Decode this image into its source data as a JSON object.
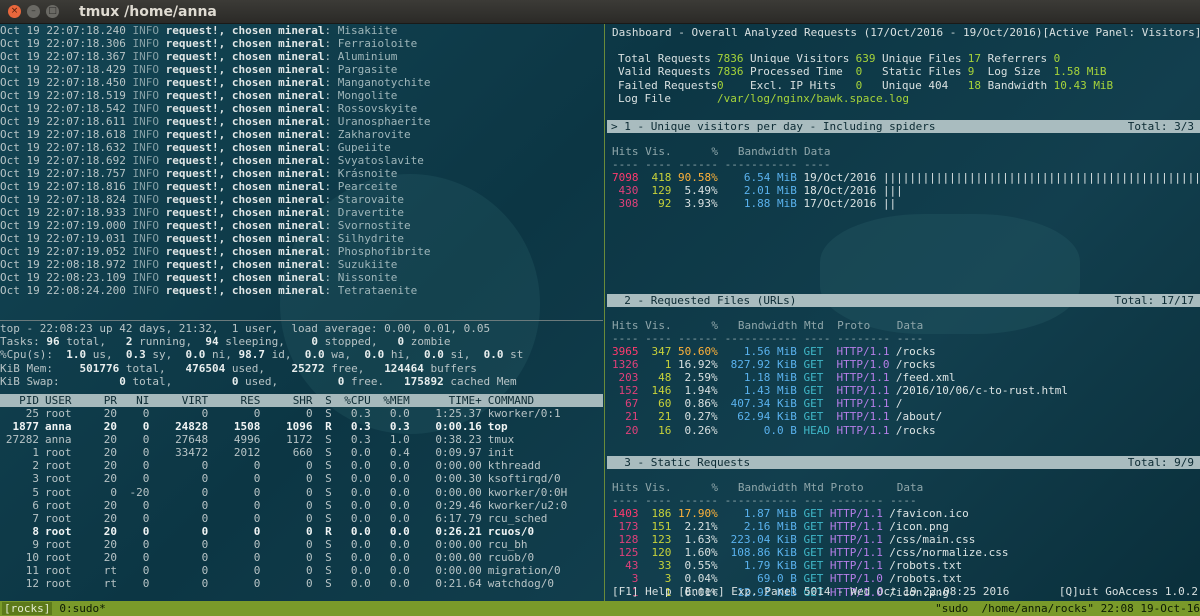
{
  "window": {
    "title": "tmux /home/anna",
    "close_glyph": "×",
    "min_glyph": "–",
    "max_glyph": "□"
  },
  "log_lines": [
    {
      "ts": "Oct 19 22:07:18.240",
      "lvl": "INFO",
      "msg1": "request!,",
      "msg2": "chosen mineral",
      "mineral": "Misakiite"
    },
    {
      "ts": "Oct 19 22:07:18.306",
      "lvl": "INFO",
      "msg1": "request!,",
      "msg2": "chosen mineral",
      "mineral": "Ferraioloite"
    },
    {
      "ts": "Oct 19 22:07:18.367",
      "lvl": "INFO",
      "msg1": "request!,",
      "msg2": "chosen mineral",
      "mineral": "Aluminium"
    },
    {
      "ts": "Oct 19 22:07:18.429",
      "lvl": "INFO",
      "msg1": "request!,",
      "msg2": "chosen mineral",
      "mineral": "Pargasite"
    },
    {
      "ts": "Oct 19 22:07:18.450",
      "lvl": "INFO",
      "msg1": "request!,",
      "msg2": "chosen mineral",
      "mineral": "Manganotychite"
    },
    {
      "ts": "Oct 19 22:07:18.519",
      "lvl": "INFO",
      "msg1": "request!,",
      "msg2": "chosen mineral",
      "mineral": "Mongolite"
    },
    {
      "ts": "Oct 19 22:07:18.542",
      "lvl": "INFO",
      "msg1": "request!,",
      "msg2": "chosen mineral",
      "mineral": "Rossovskyite"
    },
    {
      "ts": "Oct 19 22:07:18.611",
      "lvl": "INFO",
      "msg1": "request!,",
      "msg2": "chosen mineral",
      "mineral": "Uranosphaerite"
    },
    {
      "ts": "Oct 19 22:07:18.618",
      "lvl": "INFO",
      "msg1": "request!,",
      "msg2": "chosen mineral",
      "mineral": "Zakharovite"
    },
    {
      "ts": "Oct 19 22:07:18.632",
      "lvl": "INFO",
      "msg1": "request!,",
      "msg2": "chosen mineral",
      "mineral": "Gupeiite"
    },
    {
      "ts": "Oct 19 22:07:18.692",
      "lvl": "INFO",
      "msg1": "request!,",
      "msg2": "chosen mineral",
      "mineral": "Svyatoslavite"
    },
    {
      "ts": "Oct 19 22:07:18.757",
      "lvl": "INFO",
      "msg1": "request!,",
      "msg2": "chosen mineral",
      "mineral": "Krásnoite"
    },
    {
      "ts": "Oct 19 22:07:18.816",
      "lvl": "INFO",
      "msg1": "request!,",
      "msg2": "chosen mineral",
      "mineral": "Pearceite"
    },
    {
      "ts": "Oct 19 22:07:18.824",
      "lvl": "INFO",
      "msg1": "request!,",
      "msg2": "chosen mineral",
      "mineral": "Starovaite"
    },
    {
      "ts": "Oct 19 22:07:18.933",
      "lvl": "INFO",
      "msg1": "request!,",
      "msg2": "chosen mineral",
      "mineral": "Dravertite"
    },
    {
      "ts": "Oct 19 22:07:19.000",
      "lvl": "INFO",
      "msg1": "request!,",
      "msg2": "chosen mineral",
      "mineral": "Svornostite"
    },
    {
      "ts": "Oct 19 22:07:19.031",
      "lvl": "INFO",
      "msg1": "request!,",
      "msg2": "chosen mineral",
      "mineral": "Silhydrite"
    },
    {
      "ts": "Oct 19 22:07:19.052",
      "lvl": "INFO",
      "msg1": "request!,",
      "msg2": "chosen mineral",
      "mineral": "Phosphofibrite"
    },
    {
      "ts": "Oct 19 22:08:18.972",
      "lvl": "INFO",
      "msg1": "request!,",
      "msg2": "chosen mineral",
      "mineral": "Suzukiite"
    },
    {
      "ts": "Oct 19 22:08:23.109",
      "lvl": "INFO",
      "msg1": "request!,",
      "msg2": "chosen mineral",
      "mineral": "Nissonite"
    },
    {
      "ts": "Oct 19 22:08:24.200",
      "lvl": "INFO",
      "msg1": "request!,",
      "msg2": "chosen mineral",
      "mineral": "Tetrataenite"
    }
  ],
  "top": {
    "summary": "top - 22:08:23 up 42 days, 21:32,  1 user,  load average: 0.00, 0.01, 0.05",
    "tasks": {
      "label": "Tasks:",
      "total": "96",
      "total_l": "total,",
      "running": "2",
      "running_l": "running,",
      "sleeping": "94",
      "sleeping_l": "sleeping,",
      "stopped": "0",
      "stopped_l": "stopped,",
      "zombie": "0",
      "zombie_l": "zombie"
    },
    "cpu": {
      "label": "%Cpu(s):",
      "us": "1.0",
      "sy": "0.3",
      "ni": "0.0",
      "id": "98.7",
      "wa": "0.0",
      "hi": "0.0",
      "si": "0.0",
      "st": "0.0"
    },
    "mem": {
      "label": "KiB Mem:",
      "total": "501776",
      "used": "476504",
      "free": "25272",
      "buffers": "124464"
    },
    "swap": {
      "label": "KiB Swap:",
      "total": "0",
      "used": "0",
      "free": "0",
      "cached": "175892"
    },
    "header": [
      "PID",
      "USER",
      "PR",
      "NI",
      "VIRT",
      "RES",
      "SHR",
      "S",
      "%CPU",
      "%MEM",
      "TIME+",
      "COMMAND"
    ],
    "procs": [
      [
        "25",
        "root",
        "20",
        "0",
        "0",
        "0",
        "0",
        "S",
        "0.3",
        "0.0",
        "1:25.37",
        "kworker/0:1",
        false
      ],
      [
        "1877",
        "anna",
        "20",
        "0",
        "24828",
        "1508",
        "1096",
        "R",
        "0.3",
        "0.3",
        "0:00.16",
        "top",
        true
      ],
      [
        "27282",
        "anna",
        "20",
        "0",
        "27648",
        "4996",
        "1172",
        "S",
        "0.3",
        "1.0",
        "0:38.23",
        "tmux",
        false
      ],
      [
        "1",
        "root",
        "20",
        "0",
        "33472",
        "2012",
        "660",
        "S",
        "0.0",
        "0.4",
        "0:09.97",
        "init",
        false
      ],
      [
        "2",
        "root",
        "20",
        "0",
        "0",
        "0",
        "0",
        "S",
        "0.0",
        "0.0",
        "0:00.00",
        "kthreadd",
        false
      ],
      [
        "3",
        "root",
        "20",
        "0",
        "0",
        "0",
        "0",
        "S",
        "0.0",
        "0.0",
        "0:00.30",
        "ksoftirqd/0",
        false
      ],
      [
        "5",
        "root",
        "0",
        "-20",
        "0",
        "0",
        "0",
        "S",
        "0.0",
        "0.0",
        "0:00.00",
        "kworker/0:0H",
        false
      ],
      [
        "6",
        "root",
        "20",
        "0",
        "0",
        "0",
        "0",
        "S",
        "0.0",
        "0.0",
        "0:29.46",
        "kworker/u2:0",
        false
      ],
      [
        "7",
        "root",
        "20",
        "0",
        "0",
        "0",
        "0",
        "S",
        "0.0",
        "0.0",
        "6:17.79",
        "rcu_sched",
        false
      ],
      [
        "8",
        "root",
        "20",
        "0",
        "0",
        "0",
        "0",
        "R",
        "0.0",
        "0.0",
        "0:26.21",
        "rcuos/0",
        true
      ],
      [
        "9",
        "root",
        "20",
        "0",
        "0",
        "0",
        "0",
        "S",
        "0.0",
        "0.0",
        "0:00.00",
        "rcu_bh",
        false
      ],
      [
        "10",
        "root",
        "20",
        "0",
        "0",
        "0",
        "0",
        "S",
        "0.0",
        "0.0",
        "0:00.00",
        "rcuob/0",
        false
      ],
      [
        "11",
        "root",
        "rt",
        "0",
        "0",
        "0",
        "0",
        "S",
        "0.0",
        "0.0",
        "0:00.00",
        "migration/0",
        false
      ],
      [
        "12",
        "root",
        "rt",
        "0",
        "0",
        "0",
        "0",
        "S",
        "0.0",
        "0.0",
        "0:21.64",
        "watchdog/0",
        false
      ]
    ]
  },
  "goaccess": {
    "header_title": "Dashboard - Overall Analyzed Requests (17/Oct/2016 - 19/Oct/2016)",
    "active_panel": "[Active Panel: Visitors]",
    "overview": [
      [
        [
          "Total Requests",
          "7836"
        ],
        [
          "Unique Visitors",
          "639"
        ],
        [
          "Unique Files",
          "17"
        ],
        [
          "Referrers",
          "0"
        ]
      ],
      [
        [
          "Valid Requests",
          "7836"
        ],
        [
          "Processed Time",
          "0"
        ],
        [
          "Static Files",
          "9"
        ],
        [
          "Log Size",
          "1.58 MiB"
        ]
      ],
      [
        [
          "Failed Requests",
          "0"
        ],
        [
          "Excl. IP Hits",
          "0"
        ],
        [
          "Unique 404",
          "18"
        ],
        [
          "Bandwidth",
          "10.43 MiB"
        ]
      ]
    ],
    "log_file_label": "Log File",
    "log_file": "/var/log/nginx/bawk.space.log",
    "panels": [
      {
        "bar_title": "> 1 - Unique visitors per day - Including spiders",
        "total": "Total: 3/3",
        "columns": "Hits Vis.      %   Bandwidth Data",
        "underline": "---- ---- ------ ----------- ----",
        "rows": [
          {
            "hits": "7098",
            "vis": "418",
            "pct": "90.58%",
            "bw": "6.54 MiB",
            "data": "19/Oct/2016 |||||||||||||||||||||||||||||||||||||||||||||||||||||||||||||||||||",
            "top": true
          },
          {
            "hits": "430",
            "vis": "129",
            "pct": "5.49%",
            "bw": "2.01 MiB",
            "data": "18/Oct/2016 |||",
            "top": false
          },
          {
            "hits": "308",
            "vis": "92",
            "pct": "3.93%",
            "bw": "1.88 MiB",
            "data": "17/Oct/2016 ||",
            "top": false
          }
        ]
      },
      {
        "bar_title": "  2 - Requested Files (URLs)",
        "total": "Total: 17/17",
        "columns": "Hits Vis.      %   Bandwidth Mtd  Proto    Data",
        "underline": "---- ---- ------ ----------- ---- -------- ----",
        "rows": [
          {
            "hits": "3965",
            "vis": "347",
            "pct": "50.60%",
            "bw": "1.56 MiB",
            "mtd": "GET",
            "proto": "HTTP/1.1",
            "data": "/rocks",
            "top": true
          },
          {
            "hits": "1326",
            "vis": "1",
            "pct": "16.92%",
            "bw": "827.92 KiB",
            "mtd": "GET",
            "proto": "HTTP/1.0",
            "data": "/rocks",
            "top": false
          },
          {
            "hits": "203",
            "vis": "48",
            "pct": "2.59%",
            "bw": "1.18 MiB",
            "mtd": "GET",
            "proto": "HTTP/1.1",
            "data": "/feed.xml",
            "top": false
          },
          {
            "hits": "152",
            "vis": "146",
            "pct": "1.94%",
            "bw": "1.43 MiB",
            "mtd": "GET",
            "proto": "HTTP/1.1",
            "data": "/2016/10/06/c-to-rust.html",
            "top": false
          },
          {
            "hits": "67",
            "vis": "60",
            "pct": "0.86%",
            "bw": "407.34 KiB",
            "mtd": "GET",
            "proto": "HTTP/1.1",
            "data": "/",
            "top": false
          },
          {
            "hits": "21",
            "vis": "21",
            "pct": "0.27%",
            "bw": "62.94 KiB",
            "mtd": "GET",
            "proto": "HTTP/1.1",
            "data": "/about/",
            "top": false
          },
          {
            "hits": "20",
            "vis": "16",
            "pct": "0.26%",
            "bw": "0.0 B",
            "mtd": "HEAD",
            "proto": "HTTP/1.1",
            "data": "/rocks",
            "top": false
          }
        ]
      },
      {
        "bar_title": "  3 - Static Requests",
        "total": "Total: 9/9",
        "columns": "Hits Vis.      %   Bandwidth Mtd Proto     Data",
        "underline": "---- ---- ------ ----------- --- -------- ----",
        "rows": [
          {
            "hits": "1403",
            "vis": "186",
            "pct": "17.90%",
            "bw": "1.87 MiB",
            "mtd": "GET",
            "proto": "HTTP/1.1",
            "data": "/favicon.ico",
            "top": true
          },
          {
            "hits": "173",
            "vis": "151",
            "pct": "2.21%",
            "bw": "2.16 MiB",
            "mtd": "GET",
            "proto": "HTTP/1.1",
            "data": "/icon.png",
            "top": false
          },
          {
            "hits": "128",
            "vis": "123",
            "pct": "1.63%",
            "bw": "223.04 KiB",
            "mtd": "GET",
            "proto": "HTTP/1.1",
            "data": "/css/main.css",
            "top": false
          },
          {
            "hits": "125",
            "vis": "120",
            "pct": "1.60%",
            "bw": "108.86 KiB",
            "mtd": "GET",
            "proto": "HTTP/1.1",
            "data": "/css/normalize.css",
            "top": false
          },
          {
            "hits": "43",
            "vis": "33",
            "pct": "0.55%",
            "bw": "1.79 KiB",
            "mtd": "GET",
            "proto": "HTTP/1.1",
            "data": "/robots.txt",
            "top": false
          },
          {
            "hits": "3",
            "vis": "3",
            "pct": "0.04%",
            "bw": "69.0 B",
            "mtd": "GET",
            "proto": "HTTP/1.0",
            "data": "/robots.txt",
            "top": false
          },
          {
            "hits": "1",
            "vis": "1",
            "pct": "0.01%",
            "bw": "12.92 KiB",
            "mtd": "GET",
            "proto": "HTTP/1.0",
            "data": "/icon.png",
            "top": false
          }
        ]
      }
    ],
    "footer_left": "[F1] Help [Enter] Exp. Panel 5014 - Wed Oct 19 22:08:25 2016",
    "footer_right": "[Q]uit GoAccess 1.0.2"
  },
  "tmux_status": {
    "session": "[rocks]",
    "window": "0:sudo*",
    "right": "\"sudo  /home/anna/rocks\" 22:08 19-Oct-16"
  }
}
